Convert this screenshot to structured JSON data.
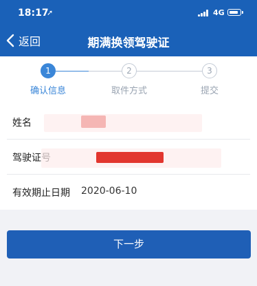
{
  "status_bar": {
    "time": "18:17",
    "location_glyph": "➚",
    "network": "4G",
    "icons": [
      "location-arrow-icon",
      "signal-bars-icon",
      "battery-icon"
    ]
  },
  "nav": {
    "back_label": "返回",
    "title": "期满换领驾驶证",
    "back_icon": "chevron-left-icon"
  },
  "steps": [
    {
      "number": "1",
      "label": "确认信息",
      "state": "active"
    },
    {
      "number": "2",
      "label": "取件方式",
      "state": "inactive"
    },
    {
      "number": "3",
      "label": "提交",
      "state": "inactive"
    }
  ],
  "fields": [
    {
      "label": "姓名",
      "value": "",
      "redacted": true
    },
    {
      "label": "驾驶证号",
      "value": "",
      "redacted": true
    },
    {
      "label": "有效期止日期",
      "value": "2020-06-10",
      "redacted": false
    }
  ],
  "next_button": {
    "label": "下一步"
  },
  "colors": {
    "header": "#1a61b8",
    "accent": "#3a86d8",
    "button": "#1f5fb6",
    "inactive": "#9aa4b2",
    "background": "#f1f2f6"
  }
}
